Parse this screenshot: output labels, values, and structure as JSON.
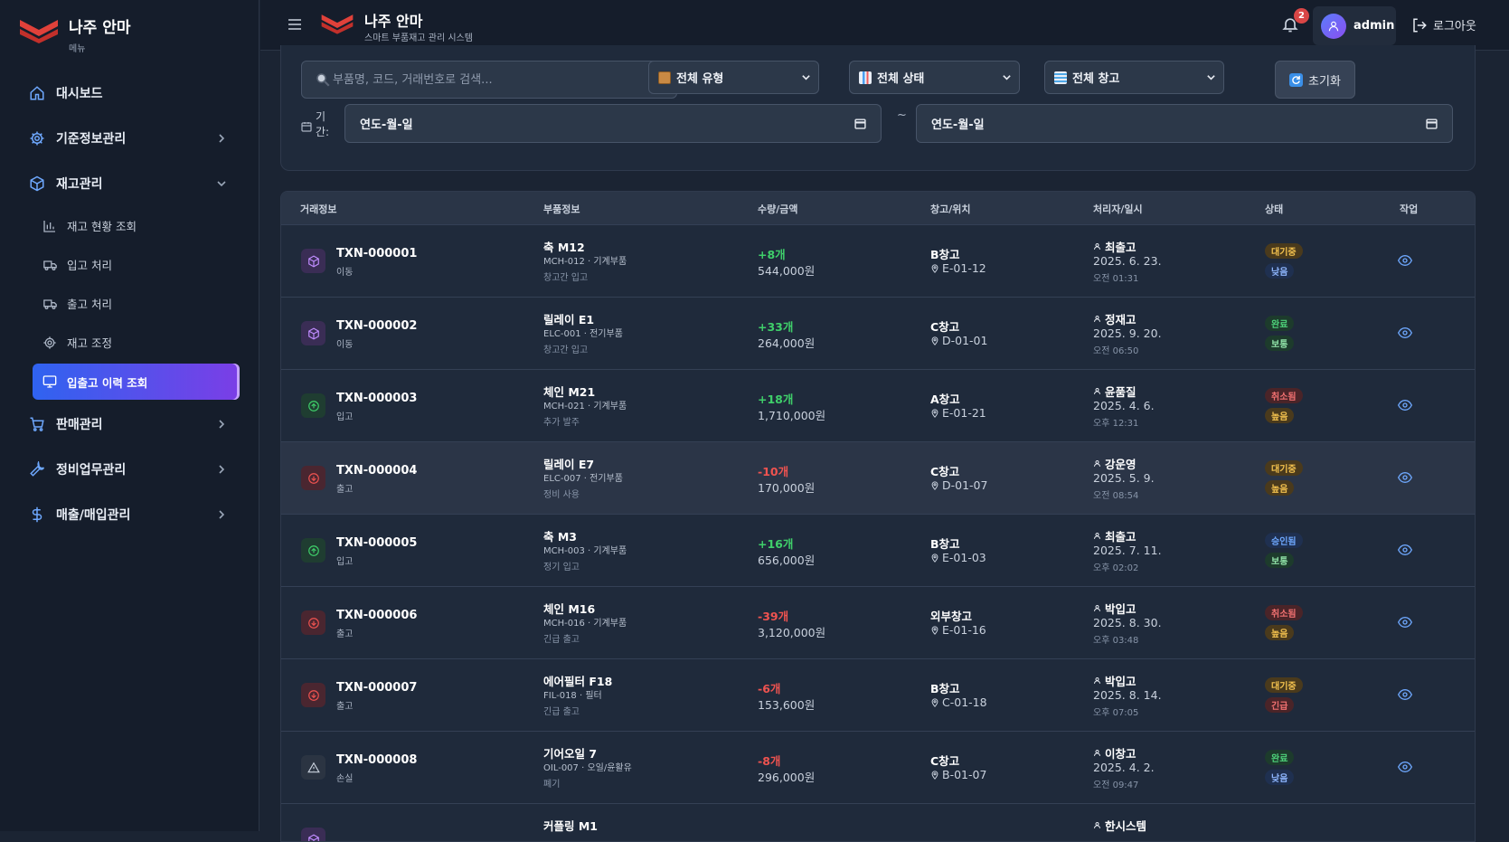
{
  "brand": {
    "title": "나주 안마",
    "subtitle": "메뉴"
  },
  "topbar": {
    "title": "나주 안마",
    "subtitle": "스마트 부품재고 관리 시스템",
    "notification_count": "2",
    "user": "admin",
    "logout": "로그아웃"
  },
  "nav": {
    "dashboard": "대시보드",
    "master": "기준정보관리",
    "inventory": "재고관리",
    "sub": [
      "재고 현황 조회",
      "입고 처리",
      "출고 처리",
      "재고 조정",
      "입출고 이력 조회"
    ],
    "sales": "판매관리",
    "maintenance": "정비업무관리",
    "finance": "매출/매입관리"
  },
  "filters": {
    "search_placeholder": "부품명, 코드, 거래번호로 검색...",
    "type": "전체 유형",
    "status": "전체 상태",
    "warehouse": "전체 창고",
    "reset": "초기화",
    "period_label": "기간:",
    "date_from": "연도-월-일",
    "tilde": "~",
    "date_to": "연도-월-일"
  },
  "table": {
    "headers": [
      "거래정보",
      "부품정보",
      "수량/금액",
      "창고/위치",
      "처리자/일시",
      "상태",
      "작업"
    ],
    "rows": [
      {
        "icon": "cube-icon",
        "kind": "move",
        "txn": "TXN-000001",
        "type": "이동",
        "part": "축 M12",
        "code": "MCH-012 · 기계부품",
        "note": "창고간 입고",
        "qty": "+8개",
        "sign": "pos",
        "amount": "544,000원",
        "wh": "B창고",
        "loc": "E-01-12",
        "who": "최출고",
        "date": "2025. 6. 23.",
        "time": "오전 01:31",
        "status": "대기중",
        "status_kind": "wait",
        "prio": "낮음",
        "prio_kind": "low"
      },
      {
        "icon": "cube-icon",
        "kind": "move",
        "txn": "TXN-000002",
        "type": "이동",
        "part": "릴레이 E1",
        "code": "ELC-001 · 전기부품",
        "note": "창고간 입고",
        "qty": "+33개",
        "sign": "pos",
        "amount": "264,000원",
        "wh": "C창고",
        "loc": "D-01-01",
        "who": "정재고",
        "date": "2025. 9. 20.",
        "time": "오전 06:50",
        "status": "완료",
        "status_kind": "done",
        "prio": "보통",
        "prio_kind": "normal"
      },
      {
        "icon": "arrow-up-circle-icon",
        "kind": "in",
        "txn": "TXN-000003",
        "type": "입고",
        "part": "체인 M21",
        "code": "MCH-021 · 기계부품",
        "note": "추가 발주",
        "qty": "+18개",
        "sign": "pos",
        "amount": "1,710,000원",
        "wh": "A창고",
        "loc": "E-01-21",
        "who": "윤품질",
        "date": "2025. 4. 6.",
        "time": "오후 12:31",
        "status": "취소됨",
        "status_kind": "cancel",
        "prio": "높음",
        "prio_kind": "high"
      },
      {
        "icon": "arrow-down-circle-icon",
        "kind": "out",
        "txn": "TXN-000004",
        "type": "출고",
        "part": "릴레이 E7",
        "code": "ELC-007 · 전기부품",
        "note": "정비 사용",
        "qty": "-10개",
        "sign": "neg",
        "amount": "170,000원",
        "wh": "C창고",
        "loc": "D-01-07",
        "who": "강운영",
        "date": "2025. 5. 9.",
        "time": "오전 08:54",
        "status": "대기중",
        "status_kind": "wait",
        "prio": "높음",
        "prio_kind": "high"
      },
      {
        "icon": "arrow-up-circle-icon",
        "kind": "in",
        "txn": "TXN-000005",
        "type": "입고",
        "part": "축 M3",
        "code": "MCH-003 · 기계부품",
        "note": "정기 입고",
        "qty": "+16개",
        "sign": "pos",
        "amount": "656,000원",
        "wh": "B창고",
        "loc": "E-01-03",
        "who": "최출고",
        "date": "2025. 7. 11.",
        "time": "오후 02:02",
        "status": "승인됨",
        "status_kind": "approved",
        "prio": "보통",
        "prio_kind": "normal"
      },
      {
        "icon": "arrow-down-circle-icon",
        "kind": "out",
        "txn": "TXN-000006",
        "type": "출고",
        "part": "체인 M16",
        "code": "MCH-016 · 기계부품",
        "note": "긴급 출고",
        "qty": "-39개",
        "sign": "neg",
        "amount": "3,120,000원",
        "wh": "외부창고",
        "loc": "E-01-16",
        "who": "박입고",
        "date": "2025. 8. 30.",
        "time": "오후 03:48",
        "status": "취소됨",
        "status_kind": "cancel",
        "prio": "높음",
        "prio_kind": "high"
      },
      {
        "icon": "arrow-down-circle-icon",
        "kind": "out",
        "txn": "TXN-000007",
        "type": "출고",
        "part": "에어필터 F18",
        "code": "FIL-018 · 필터",
        "note": "긴급 출고",
        "qty": "-6개",
        "sign": "neg",
        "amount": "153,600원",
        "wh": "B창고",
        "loc": "C-01-18",
        "who": "박입고",
        "date": "2025. 8. 14.",
        "time": "오후 07:05",
        "status": "대기중",
        "status_kind": "wait",
        "prio": "긴급",
        "prio_kind": "urgent"
      },
      {
        "icon": "warning-icon",
        "kind": "loss",
        "txn": "TXN-000008",
        "type": "손실",
        "part": "기어오일 7",
        "code": "OIL-007 · 오일/윤활유",
        "note": "폐기",
        "qty": "-8개",
        "sign": "neg",
        "amount": "296,000원",
        "wh": "C창고",
        "loc": "B-01-07",
        "who": "이창고",
        "date": "2025. 4. 2.",
        "time": "오전 09:47",
        "status": "완료",
        "status_kind": "done",
        "prio": "낮음",
        "prio_kind": "low"
      },
      {
        "icon": "cube-icon",
        "kind": "move",
        "txn": "",
        "type": "",
        "part": "커플링 M1",
        "code": "",
        "note": "",
        "qty": "",
        "sign": "pos",
        "amount": "",
        "wh": "",
        "loc": "",
        "who": "한시스템",
        "date": "",
        "time": "",
        "status": "",
        "status_kind": "approved",
        "prio": "",
        "prio_kind": "normal"
      }
    ]
  },
  "colors": {
    "accent_start": "#2f63f0",
    "accent_end": "#7b3ee6",
    "positive": "#3fcf6a",
    "negative": "#ef5350",
    "brand_red": "#e0413a"
  }
}
